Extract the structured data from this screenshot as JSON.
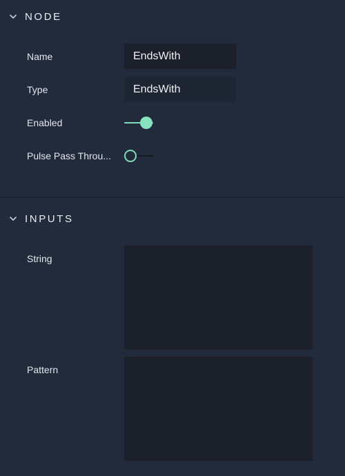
{
  "node_section": {
    "title": "NODE",
    "rows": {
      "name": {
        "label": "Name",
        "value": "EndsWith"
      },
      "type": {
        "label": "Type",
        "value": "EndsWith"
      },
      "enabled": {
        "label": "Enabled",
        "state": "on"
      },
      "pulse": {
        "label": "Pulse Pass Throu...",
        "state": "off"
      }
    }
  },
  "inputs_section": {
    "title": "INPUTS",
    "rows": {
      "string": {
        "label": "String",
        "value": ""
      },
      "pattern": {
        "label": "Pattern",
        "value": ""
      }
    }
  },
  "colors": {
    "background": "#222b3b",
    "field": "#1b202a",
    "accent": "#7fdcb4",
    "text": "#e6e9ee"
  },
  "icons": {
    "section_toggle": "chevron-down-icon"
  }
}
